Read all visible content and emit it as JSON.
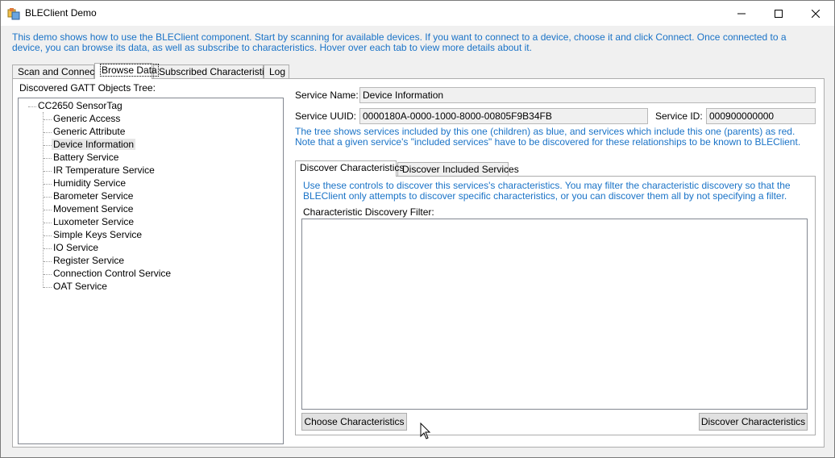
{
  "window": {
    "title": "BLEClient Demo",
    "controls": {
      "minimize": "minimize",
      "maximize": "maximize",
      "close": "close"
    }
  },
  "intro": "This demo shows how to use the BLEClient component. Start by scanning for available devices. If you want to connect to a device, choose it and click Connect. Once connected to a device, you can browse its data, as well as subscribe to characteristics. Hover over each tab to view more details about it.",
  "tabs": [
    {
      "label": "Scan and Connect"
    },
    {
      "label": "Browse Data",
      "active": true
    },
    {
      "label": "Subscribed Characteristics"
    },
    {
      "label": "Log"
    }
  ],
  "tree": {
    "heading": "Discovered GATT Objects Tree:",
    "root": "CC2650 SensorTag",
    "items": [
      "Generic Access",
      "Generic Attribute",
      "Device Information",
      "Battery Service",
      "IR Temperature Service",
      "Humidity Service",
      "Barometer Service",
      "Movement Service",
      "Luxometer Service",
      "Simple Keys Service",
      "IO Service",
      "Register Service",
      "Connection Control Service",
      "OAT Service"
    ],
    "selected": "Device Information"
  },
  "service": {
    "name_label": "Service Name:",
    "name_value": "Device Information",
    "uuid_label": "Service UUID:",
    "uuid_value": "0000180A-0000-1000-8000-00805F9B34FB",
    "id_label": "Service ID:",
    "id_value": "000900000000",
    "note": "The tree shows services included by this one (children) as blue, and services which include this one (parents) as red. Note that a given service's \"included services\" have to be discovered for these relationships to be known to BLEClient."
  },
  "inner_tabs": [
    {
      "label": "Discover Characteristics",
      "active": true
    },
    {
      "label": "Discover Included Services"
    }
  ],
  "discover": {
    "note": "Use these controls to discover this services's characteristics. You may filter the characteristic discovery so that the BLEClient only attempts to discover specific characteristics, or you can discover them all by not specifying a filter.",
    "filter_label": "Characteristic Discovery Filter:",
    "filter_value": "",
    "choose_button": "Choose Characteristics",
    "discover_button": "Discover Characteristics"
  },
  "colors": {
    "info_text": "#1a73c7",
    "window_bg": "#f0f0f0"
  }
}
